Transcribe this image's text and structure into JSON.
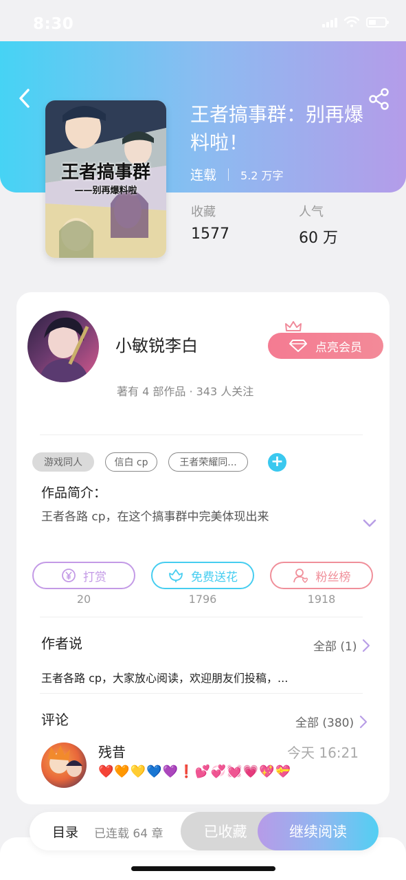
{
  "status_bar": {
    "time": "8:30"
  },
  "book": {
    "title": "王者搞事群：别再爆料啦！",
    "status": "连载",
    "word_count": "5.2 万字",
    "cover_title": "王者搞事群",
    "cover_subtitle": "——别再爆料啦",
    "stats": [
      {
        "label": "收藏",
        "value": "1577"
      },
      {
        "label": "人气",
        "value": "60 万"
      }
    ]
  },
  "author": {
    "name": "小敏锐李白",
    "stats": "著有 4 部作品 · 343 人关注",
    "vip_label": "点亮会员"
  },
  "tags": [
    "游戏同人",
    "信白 cp",
    "王者荣耀同..."
  ],
  "intro": {
    "heading": "作品简介：",
    "text": "王者各路 cp，在这个搞事群中完美体现出来"
  },
  "actions": [
    {
      "label": "打赏",
      "count": "20",
      "icon": "yen-coin-icon",
      "color": "#c39ae6"
    },
    {
      "label": "免费送花",
      "count": "1796",
      "icon": "flower-icon",
      "color": "#46cdf0"
    },
    {
      "label": "粉丝榜",
      "count": "1918",
      "icon": "user-fans-icon",
      "color": "#f08f9a"
    }
  ],
  "author_says": {
    "title": "作者说",
    "more": "全部 (1)",
    "text": "王者各路 cp，大家放心阅读，欢迎朋友们投稿，..."
  },
  "comments": {
    "title": "评论",
    "more": "全部 (380)",
    "latest": {
      "name": "残昔",
      "time": "今天 16:21",
      "text": "❤️🧡💛💙💜❗💕💞💓💗💖💝"
    }
  },
  "bottom_bar": {
    "toc": "目录",
    "chapters": "已连载 64 章",
    "collected": "已收藏",
    "continue": "继续阅读"
  },
  "colors": {
    "header_gradient": [
      "#46d3f4",
      "#b49ce9"
    ],
    "vip": "#f47b92",
    "accent_blue": "#3ac8ef"
  }
}
